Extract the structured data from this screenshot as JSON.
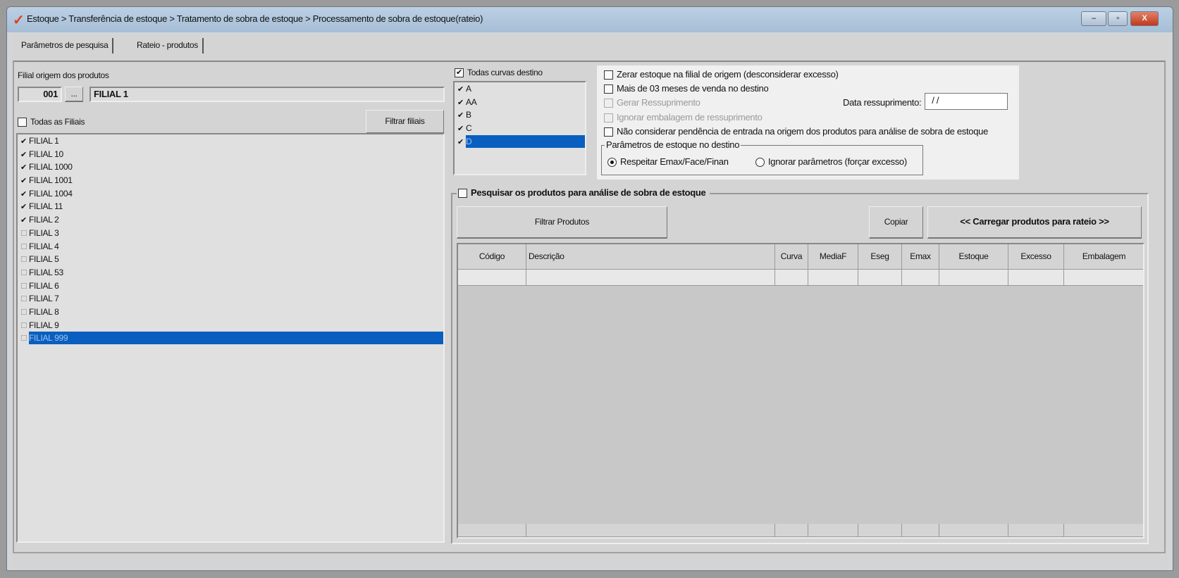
{
  "window": {
    "title": "Estoque > Transferência de estoque > Tratamento de sobra de estoque > Processamento de sobra de estoque(rateio)",
    "minimize": "‒",
    "maximize": "▫",
    "close": "X"
  },
  "tabs": [
    {
      "label": "Parâmetros de pesquisa",
      "active": true
    },
    {
      "label": "Rateio - produtos",
      "active": false
    }
  ],
  "origem": {
    "label": "Filial origem dos produtos",
    "code": "001",
    "lookup": "...",
    "name": "FILIAL 1"
  },
  "filiais": {
    "all_label": "Todas as Filiais",
    "all_checked": false,
    "filter_button": "Filtrar filiais",
    "items": [
      {
        "label": "FILIAL 1",
        "checked": true
      },
      {
        "label": "FILIAL 10",
        "checked": true
      },
      {
        "label": "FILIAL 1000",
        "checked": true
      },
      {
        "label": "FILIAL 1001",
        "checked": true
      },
      {
        "label": "FILIAL 1004",
        "checked": true
      },
      {
        "label": "FILIAL 11",
        "checked": true
      },
      {
        "label": "FILIAL 2",
        "checked": true
      },
      {
        "label": "FILIAL 3",
        "checked": false
      },
      {
        "label": "FILIAL 4",
        "checked": false
      },
      {
        "label": "FILIAL 5",
        "checked": false
      },
      {
        "label": "FILIAL 53",
        "checked": false
      },
      {
        "label": "FILIAL 6",
        "checked": false
      },
      {
        "label": "FILIAL 7",
        "checked": false
      },
      {
        "label": "FILIAL 8",
        "checked": false
      },
      {
        "label": "FILIAL 9",
        "checked": false
      },
      {
        "label": "FILIAL 999",
        "checked": false,
        "selected": true
      }
    ]
  },
  "curvas": {
    "all_label": "Todas curvas destino",
    "all_checked": true,
    "items": [
      {
        "label": "A",
        "checked": true
      },
      {
        "label": "AA",
        "checked": true
      },
      {
        "label": "B",
        "checked": true
      },
      {
        "label": "C",
        "checked": true
      },
      {
        "label": "D",
        "checked": true,
        "selected": true
      }
    ]
  },
  "options": {
    "zerar": "Zerar estoque na filial de origem (desconsiderar excesso)",
    "mais3": "Mais de 03 meses de venda no destino",
    "gerar": "Gerar Ressuprimento",
    "ignorar_emb": "Ignorar embalagem de ressuprimento",
    "nao_considerar": "Não considerar pendência de entrada na origem dos produtos para análise de sobra de estoque",
    "data_label": "Data ressuprimento:",
    "data_value": " / /",
    "group_title": "Parâmetros de estoque no destino",
    "radio1": "Respeitar Emax/Face/Finan",
    "radio2": "Ignorar parâmetros (forçar excesso)"
  },
  "pesquisa": {
    "title": "Pesquisar os produtos para análise de sobra de estoque",
    "filtrar": "Filtrar Produtos",
    "copiar": "Copiar",
    "carregar": "<< Carregar produtos para rateio >>",
    "columns": [
      "Código",
      "Descrição",
      "Curva",
      "MediaF",
      "Eseg",
      "Emax",
      "Estoque",
      "Excesso",
      "Embalagem"
    ]
  }
}
